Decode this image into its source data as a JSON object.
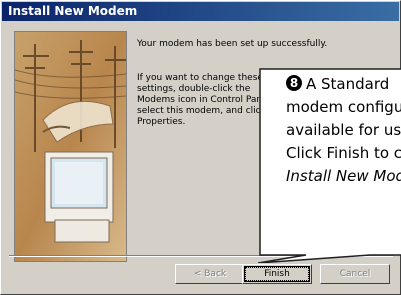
{
  "window": {
    "title": "Install New Modem"
  },
  "content": {
    "success_message": "Your modem has been set up successfully.",
    "change_settings_text": "If you want to change these settings, double-click the Modems icon in Control Panel, select this modem, and click Properties."
  },
  "buttons": {
    "back_label": "< Back",
    "finish_label": "Finish",
    "cancel_label": "Cancel"
  },
  "annotation": {
    "step_number": "8",
    "line1": "A Standard",
    "line2": "modem configuration is",
    "line3": "available for use.",
    "line4": "Click Finish to close the",
    "line5": "Install New Modem"
  },
  "colors": {
    "titlebar_start": "#0a246a",
    "titlebar_end": "#3a6ea5",
    "dialog_face": "#d4d0c8"
  }
}
